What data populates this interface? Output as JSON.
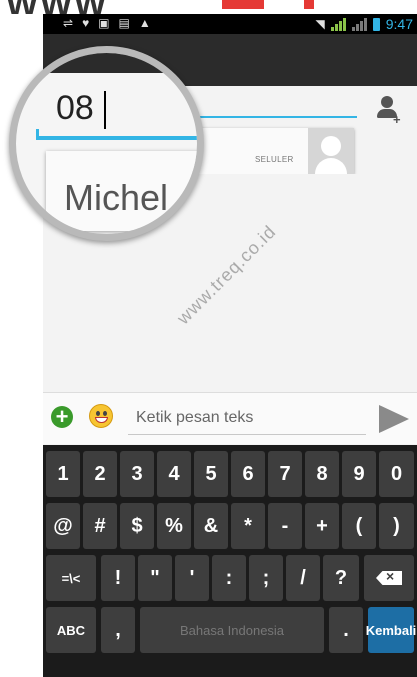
{
  "status_bar": {
    "time": "9:47"
  },
  "recipient": {
    "typed_value": "08",
    "suggestion_label": "SELULER",
    "suggestion_name_partial": "Michel"
  },
  "compose": {
    "placeholder": "Ketik pesan teks"
  },
  "watermark": "www.treq.co.id",
  "keyboard": {
    "row1": [
      "1",
      "2",
      "3",
      "4",
      "5",
      "6",
      "7",
      "8",
      "9",
      "0"
    ],
    "row2": [
      "@",
      "#",
      "$",
      "%",
      "&",
      "*",
      "-",
      "+",
      "(",
      ")"
    ],
    "row3": [
      "=\\<",
      "!",
      "\"",
      "'",
      ":",
      ";",
      "/",
      "?"
    ],
    "row4": {
      "mode": "ABC",
      "comma": ",",
      "space": "Bahasa Indonesia",
      "period": ".",
      "enter": "Kembali"
    }
  },
  "colors": {
    "accent": "#33b5e5",
    "send_enter": "#1d6ea5",
    "add_button": "#3a9a2b"
  }
}
